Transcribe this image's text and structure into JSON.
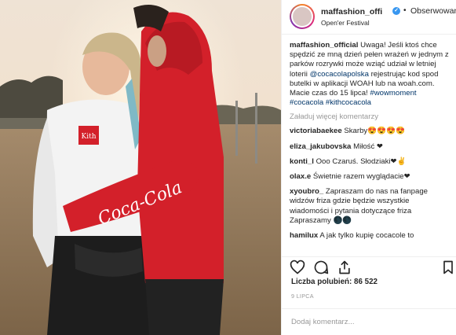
{
  "post": {
    "username": "maffashion_offi",
    "location": "Open'er Festival",
    "follow_label": "Obserwowan",
    "separator": "•"
  },
  "caption": {
    "username": "maffashion_official",
    "text_1": " Uwaga! Jeśli ktoś chce spędzić ze mną dzień pełen wrażeń w jednym z parków rozrywki może wziąć udział w letniej loterii ",
    "mention": "@cocacolapolska",
    "text_2": " rejestrując kod spod butelki w aplikacji WOAH lub na woah.com. Macie czas do 15 lipca! ",
    "tag_1": "#wowmoment",
    "tag_2": "#cocacola",
    "tag_3": "#kithcocacola"
  },
  "load_more": "Załaduj więcej komentarzy",
  "comments": [
    {
      "user": "victoriabaekee",
      "text": " Skarby😍😍😍😍"
    },
    {
      "user": "eliza_jakubovska",
      "text": " Miłość ❤"
    },
    {
      "user": "konti_l",
      "text": " Ooo Czaruś. Słodziaki❤✌"
    },
    {
      "user": "olax.e",
      "text": " Świetnie razem wyglądacie❤"
    },
    {
      "user": "xyoubro_",
      "text": " Zapraszam do nas na fanpage widzów friza gdzie będzie wszystkie wiadomości i pytania dotyczące friza Zapraszamy 🌑🌑"
    },
    {
      "user": "hamilux",
      "text": " A jak tylko kupię cocacole to"
    }
  ],
  "likes_text": "Liczba polubień: 86 522",
  "date_text": "9 LIPCA",
  "add_comment_placeholder": "Dodaj komentarz...",
  "photo": {
    "hoodie_brand": "Kith",
    "sleeve_text": "Coca-Cola"
  },
  "icons": [
    "heart-icon",
    "comment-icon",
    "share-icon",
    "bookmark-icon",
    "verified-icon"
  ],
  "colors": {
    "link": "#003569",
    "verified": "#3897f0",
    "hoodie_red": "#d3202a",
    "muted": "#999999"
  }
}
